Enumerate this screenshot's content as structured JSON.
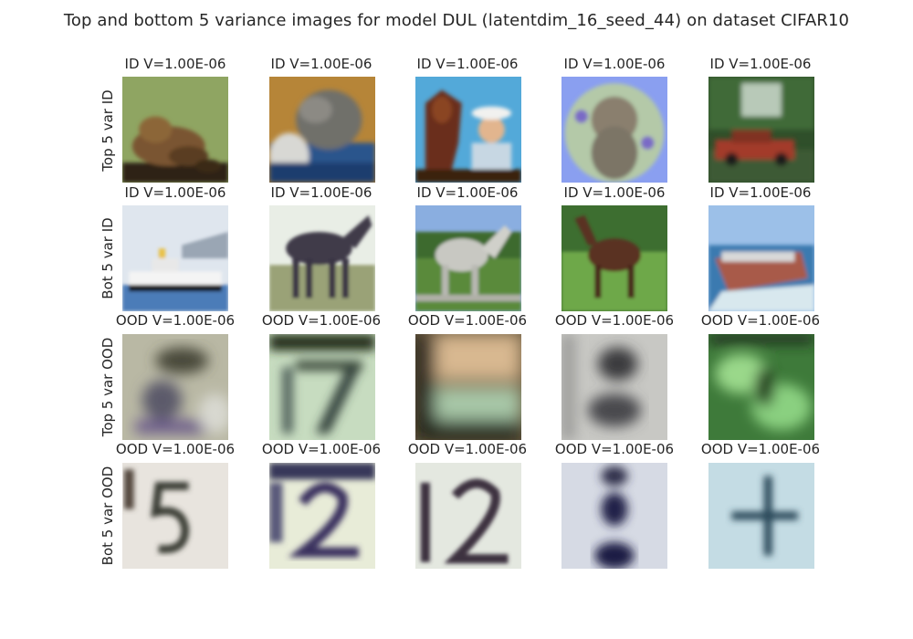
{
  "figure": {
    "title": "Top and bottom 5 variance images for model DUL (latentdim_16_seed_44) on dataset CIFAR10"
  },
  "rows": [
    {
      "label": "Top 5 var ID",
      "cells": [
        {
          "title": "ID V=1.00E-06",
          "subject": "frog"
        },
        {
          "title": "ID V=1.00E-06",
          "subject": "cat"
        },
        {
          "title": "ID V=1.00E-06",
          "subject": "horse and person"
        },
        {
          "title": "ID V=1.00E-06",
          "subject": "cat"
        },
        {
          "title": "ID V=1.00E-06",
          "subject": "car"
        }
      ]
    },
    {
      "label": "Bot 5 var ID",
      "cells": [
        {
          "title": "ID V=1.00E-06",
          "subject": "ship"
        },
        {
          "title": "ID V=1.00E-06",
          "subject": "horse"
        },
        {
          "title": "ID V=1.00E-06",
          "subject": "horse"
        },
        {
          "title": "ID V=1.00E-06",
          "subject": "horse"
        },
        {
          "title": "ID V=1.00E-06",
          "subject": "ship"
        }
      ]
    },
    {
      "label": "Top 5 var OOD",
      "cells": [
        {
          "title": "OOD V=1.00E-06",
          "subject": "blurry digit"
        },
        {
          "title": "OOD V=1.00E-06",
          "subject": "blurry digit"
        },
        {
          "title": "OOD V=1.00E-06",
          "subject": "blurry digit"
        },
        {
          "title": "OOD V=1.00E-06",
          "subject": "blurry digit"
        },
        {
          "title": "OOD V=1.00E-06",
          "subject": "blurry digit"
        }
      ]
    },
    {
      "label": "Bot 5 var OOD",
      "cells": [
        {
          "title": "OOD V=1.00E-06",
          "subject": "digit"
        },
        {
          "title": "OOD V=1.00E-06",
          "subject": "digit"
        },
        {
          "title": "OOD V=1.00E-06",
          "subject": "digit"
        },
        {
          "title": "OOD V=1.00E-06",
          "subject": "digit"
        },
        {
          "title": "OOD V=1.00E-06",
          "subject": "digit"
        }
      ]
    }
  ]
}
